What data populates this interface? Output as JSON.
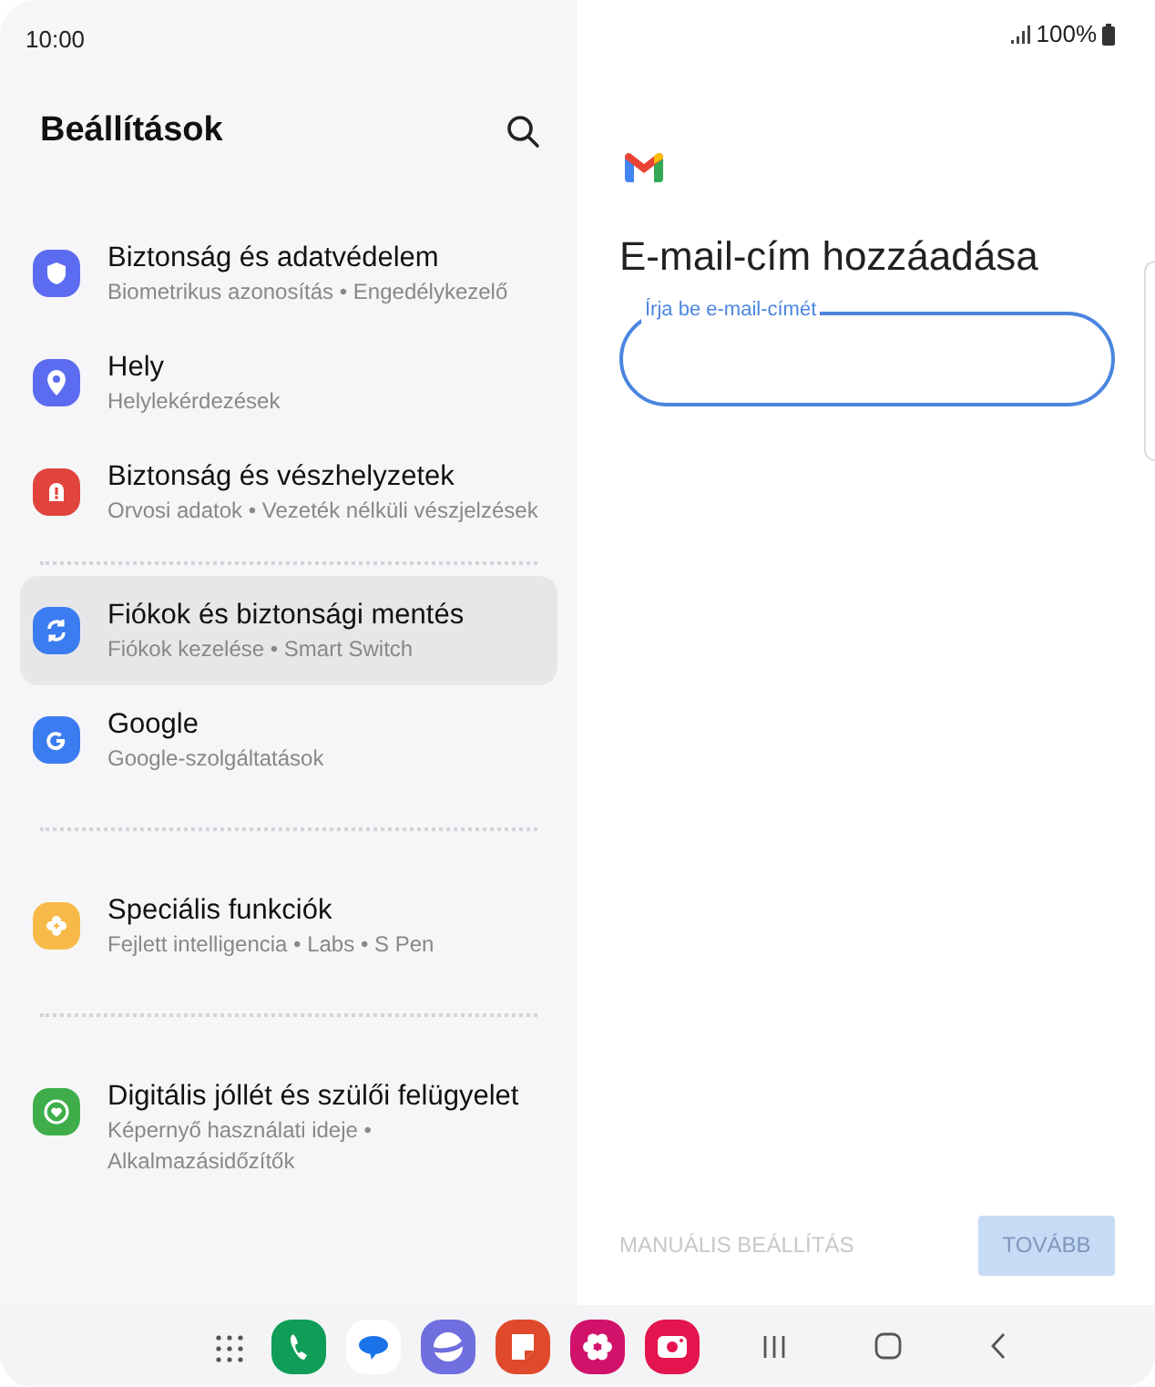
{
  "status_bar": {
    "time": "10:00",
    "battery": "100%"
  },
  "settings": {
    "title": "Beállítások",
    "groups": [
      [
        {
          "kind": "shield",
          "color": "#5b6cf0",
          "title": "Biztonság és adatvédelem",
          "subtitle": "Biometrikus azonosítás • Engedélykezelő",
          "selected": false
        },
        {
          "kind": "pin",
          "color": "#5b6cf0",
          "title": "Hely",
          "subtitle": "Helylekérdezések",
          "selected": false
        },
        {
          "kind": "alert",
          "color": "#e0443c",
          "title": "Biztonság és vészhelyzetek",
          "subtitle": "Orvosi adatok • Vezeték nélküli vészjelzések",
          "selected": false
        }
      ],
      [
        {
          "kind": "sync",
          "color": "#3b7cf0",
          "title": "Fiókok és biztonsági mentés",
          "subtitle": "Fiókok kezelése • Smart Switch",
          "selected": true
        },
        {
          "kind": "google",
          "color": "#3b7cf0",
          "title": "Google",
          "subtitle": "Google-szolgáltatások",
          "selected": false
        }
      ],
      [
        {
          "kind": "gear",
          "color": "#f7b948",
          "title": "Speciális funkciók",
          "subtitle": "Fejlett intelligencia • Labs • S Pen",
          "selected": false
        }
      ],
      [
        {
          "kind": "heart",
          "color": "#3fae4a",
          "title": "Digitális jóllét és szülői felügyelet",
          "subtitle": "Képernyő használati ideje • Alkalmazásidőzítők",
          "selected": false
        }
      ]
    ]
  },
  "email": {
    "heading": "E-mail-cím hozzáadása",
    "field_label": "Írja be e-mail-címét",
    "manual_button": "MANUÁLIS BEÁLLÍTÁS",
    "next_button": "TOVÁBB"
  },
  "dock": [
    {
      "kind": "grid"
    },
    {
      "kind": "phone"
    },
    {
      "kind": "messages"
    },
    {
      "kind": "browser"
    },
    {
      "kind": "notes"
    },
    {
      "kind": "gallery"
    },
    {
      "kind": "camera"
    }
  ]
}
